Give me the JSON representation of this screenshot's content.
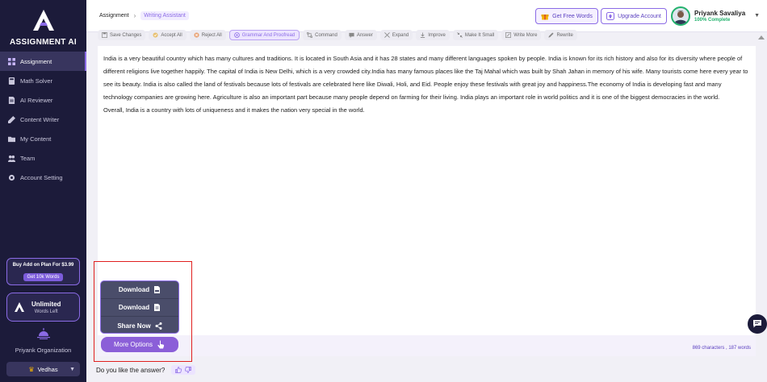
{
  "brand": {
    "name": "ASSIGNMENT AI"
  },
  "sidebar": {
    "items": [
      {
        "label": "Assignment",
        "icon": "grid-icon",
        "active": true
      },
      {
        "label": "Math Solver",
        "icon": "calculator-icon"
      },
      {
        "label": "AI Reviewer",
        "icon": "document-icon"
      },
      {
        "label": "Content Writer",
        "icon": "pen-icon"
      },
      {
        "label": "My Content",
        "icon": "folder-icon"
      },
      {
        "label": "Team",
        "icon": "team-icon"
      },
      {
        "label": "Account Setting",
        "icon": "gear-icon"
      }
    ],
    "promo": {
      "title": "Buy Add on Plan For $3.99",
      "badge": "Get 10k Words"
    },
    "plan": {
      "title": "Unlimited",
      "subtitle": "Words Left"
    },
    "organization": {
      "name": "Priyank Organization",
      "selected": "Vedhas"
    }
  },
  "header": {
    "breadcrumb": [
      "Assignment",
      "Writing Assistant"
    ],
    "free_words_label": "Get Free Words",
    "upgrade_label": "Upgrade Account",
    "user": {
      "name": "Priyank Savaliya",
      "status": "100% Complete"
    }
  },
  "toolbar": [
    {
      "label": "Save Changes",
      "icon": "save-icon"
    },
    {
      "label": "Accept All",
      "icon": "check-circle-icon"
    },
    {
      "label": "Reject All",
      "icon": "x-circle-icon"
    },
    {
      "label": "Grammar And Proofread",
      "icon": "grammar-icon",
      "active": true
    },
    {
      "label": "Command",
      "icon": "command-icon"
    },
    {
      "label": "Answer",
      "icon": "answer-icon"
    },
    {
      "label": "Expand",
      "icon": "expand-icon"
    },
    {
      "label": "Improve",
      "icon": "improve-icon"
    },
    {
      "label": "Make It Small",
      "icon": "shrink-icon"
    },
    {
      "label": "Write More",
      "icon": "write-more-icon"
    },
    {
      "label": "Rewrite",
      "icon": "rewrite-icon"
    }
  ],
  "editor": {
    "paragraphs": [
      "India is a very beautiful country which has many cultures and traditions. It is located in South Asia and it has 28 states and many different languages spoken by people. India is known for its rich history and also for its diversity where people of different religions live together happily. The capital of India is New Delhi, which is a very crowded city.India has many famous places like the Taj Mahal which was built by Shah Jahan in memory of his wife. Many tourists come here every year to see its beauty. India is also called the land of festivals because lots of festivals are celebrated here like Diwali, Holi, and Eid. People enjoy these festivals with great joy and happiness.The economy of India is developing fast and many technology companies are growing here. Agriculture is also an important part because many people depend on farming for their living. India plays an important role in world politics and it is one of the biggest democracies in the world.",
      "Overall, India is a country with lots of uniqueness and it makes the nation very special in the world."
    ],
    "counts": "869 characters , 187 words"
  },
  "float_menu": {
    "items": [
      {
        "label": "Download",
        "icon": "pdf-icon"
      },
      {
        "label": "Download",
        "icon": "doc-icon"
      },
      {
        "label": "Share Now",
        "icon": "share-icon"
      }
    ],
    "more_label": "More Options"
  },
  "feedback": {
    "question": "Do you like the answer?"
  },
  "colors": {
    "accent": "#8b6be6",
    "sidebar": "#1c1b3a",
    "highlight": "#e0201e",
    "success": "#23b26d"
  }
}
